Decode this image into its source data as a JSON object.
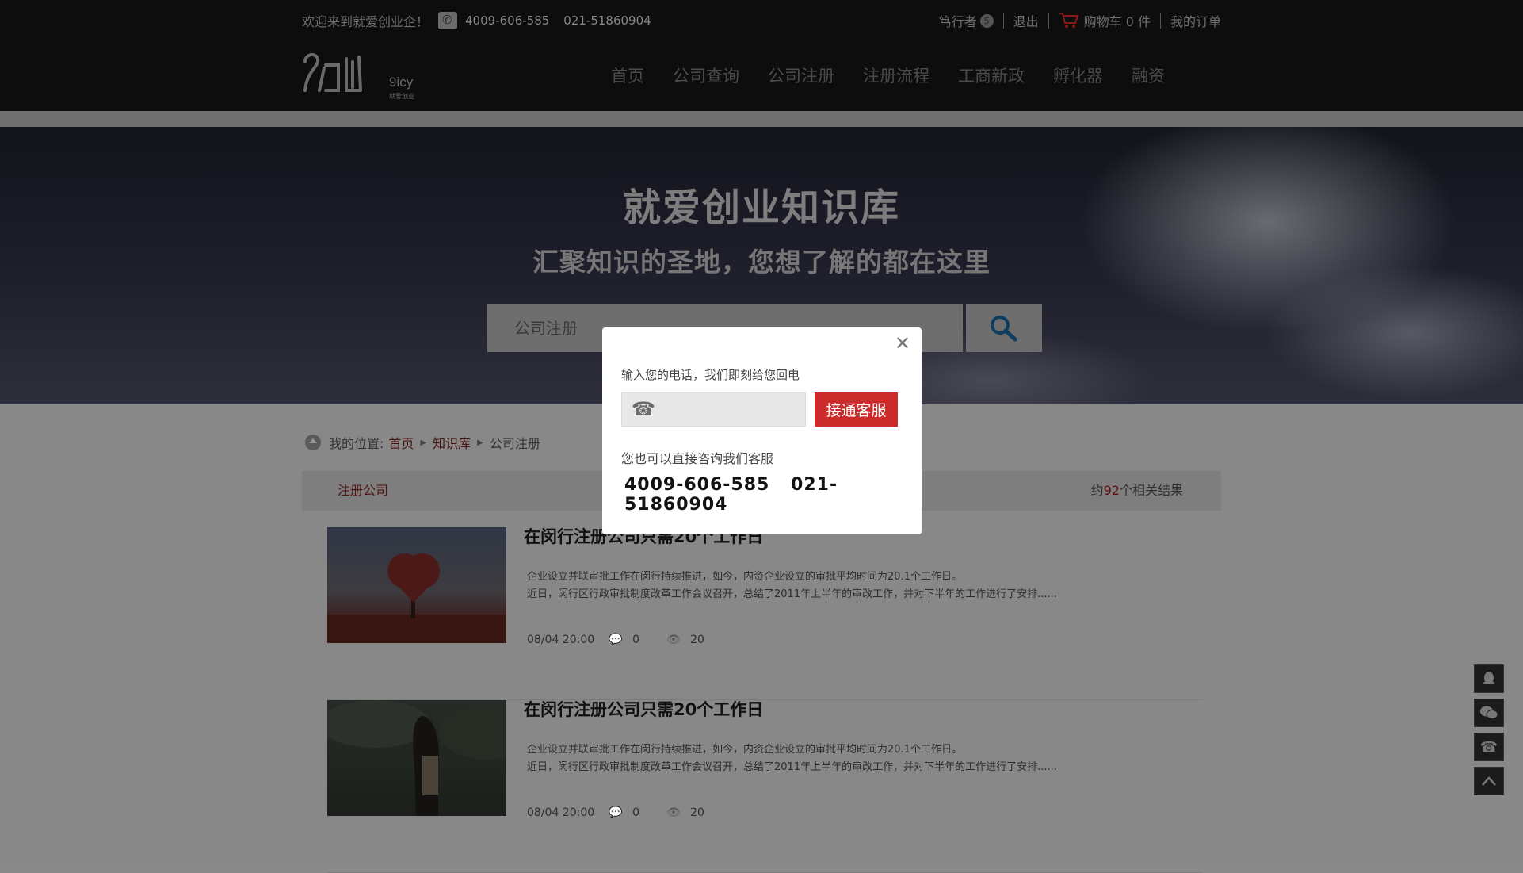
{
  "topbar": {
    "welcome": "欢迎来到就爱创业企！",
    "phone1": "4009-606-585",
    "phone2": "021-51860904",
    "user": "笃行者",
    "user_badge": "5",
    "logout": "退出",
    "cart": "购物车 0 件",
    "orders": "我的订单"
  },
  "logo": {
    "mark": "9icy",
    "sub": "就爱创业"
  },
  "nav": [
    "首页",
    "公司查询",
    "公司注册",
    "注册流程",
    "工商新政",
    "孵化器",
    "融资"
  ],
  "hero": {
    "title": "就爱创业知识库",
    "subtitle": "汇聚知识的圣地，您想了解的都在这里",
    "search_value": "公司注册"
  },
  "breadcrumb": {
    "label": "我的位置:",
    "items": [
      "首页",
      "知识库",
      "公司注册"
    ]
  },
  "results": {
    "category": "注册公司",
    "prefix": "约",
    "count": "92",
    "suffix": "个相关结果"
  },
  "articles": [
    {
      "title": "在闵行注册公司只需20个工作日",
      "line1": "企业设立并联审批工作在闵行持续推进，如今，内资企业设立的审批平均时间为20.1个工作日。",
      "line2": "近日，闵行区行政审批制度改革工作会议召开，总结了2011年上半年的审改工作，并对下半年的工作进行了安排......",
      "date": "08/04 20:00",
      "comments": "0",
      "views": "20"
    },
    {
      "title": "在闵行注册公司只需20个工作日",
      "line1": "企业设立并联审批工作在闵行持续推进，如今，内资企业设立的审批平均时间为20.1个工作日。",
      "line2": "近日，闵行区行政审批制度改革工作会议召开，总结了2011年上半年的审改工作，并对下半年的工作进行了安排......",
      "date": "08/04 20:00",
      "comments": "0",
      "views": "20"
    }
  ],
  "modal": {
    "prompt": "输入您的电话，我们即刻给您回电",
    "call_button": "接通客服",
    "alt_text": "您也可以直接咨询我们客服",
    "phone1": "4009-606-585",
    "phone2": "021-51860904"
  },
  "colors": {
    "accent_red": "#cc2b2b",
    "dark_red_link": "#4a1412"
  }
}
